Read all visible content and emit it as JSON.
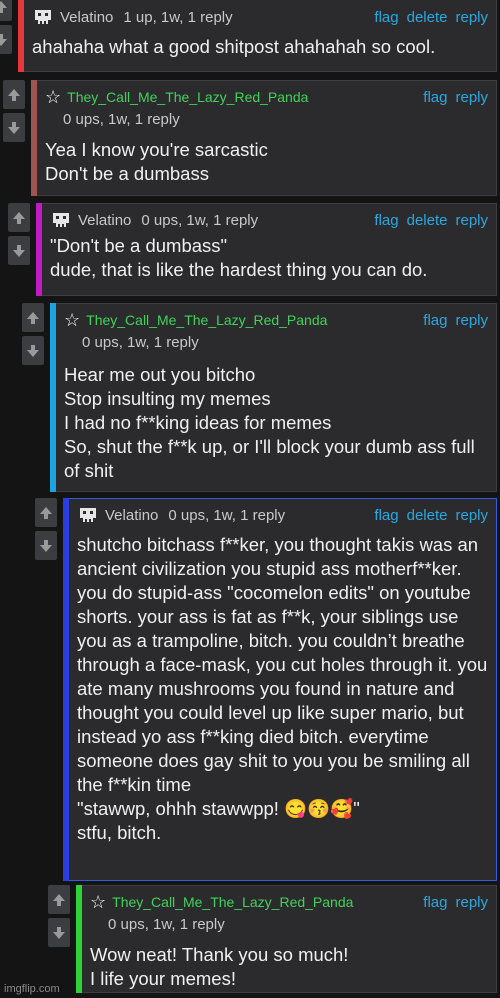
{
  "actions": {
    "flag": "flag",
    "delete": "delete",
    "reply": "reply"
  },
  "comments": [
    {
      "user": "Velatino",
      "meta": "1 up, 1w, 1 reply",
      "body": "ahahaha what a good shitpost ahahahah so cool.",
      "color": "#e8373a"
    },
    {
      "user": "They_Call_Me_The_Lazy_Red_Panda",
      "meta": "0 ups, 1w, 1 reply",
      "body": "Yea I know you're sarcastic\nDon't be a dumbass",
      "color": "#9e5552"
    },
    {
      "user": "Velatino",
      "meta": "0 ups, 1w, 1 reply",
      "body": "\"Don't be a dumbass\"\ndude, that is like the hardest thing you can do.",
      "color": "#c21bc6"
    },
    {
      "user": "They_Call_Me_The_Lazy_Red_Panda",
      "meta": "0 ups, 1w, 1 reply",
      "body": "Hear me out you bitcho\nStop insulting my memes\nI had no f**king ideas for memes\nSo, shut the f**k up, or I'll block your dumb ass full of shit",
      "color": "#1ba5e0"
    },
    {
      "user": "Velatino",
      "meta": "0 ups, 1w, 1 reply",
      "body": "shutcho bitchass f**ker, you thought takis was an ancient civilization you stupid ass motherf**ker. you do stupid-ass \"cocomelon edits\" on youtube shorts. your ass is fat as f**k, your siblings use you as a trampoline, bitch. you couldn’t breathe through a face-mask, you cut holes through it. you ate many mushrooms you found in nature and thought you could level up like super mario, but instead yo ass f**king died bitch. everytime someone does gay shit to you you be smiling all the f**kin time\n\"stawwp, ohhh stawwpp! 😋😚🥰\"\nstfu, bitch.",
      "color": "#2a3fe0"
    },
    {
      "user": "They_Call_Me_The_Lazy_Red_Panda",
      "meta": "0 ups, 1w, 1 reply",
      "body": "Wow neat! Thank you so much!\nI life your memes!",
      "color": "#2fd234"
    }
  ],
  "watermark": "imgflip.com",
  "icons": {
    "up": "arrow-up-icon",
    "down": "arrow-down-icon",
    "avatar": "pixel-avatar-icon",
    "star": "star-icon"
  }
}
